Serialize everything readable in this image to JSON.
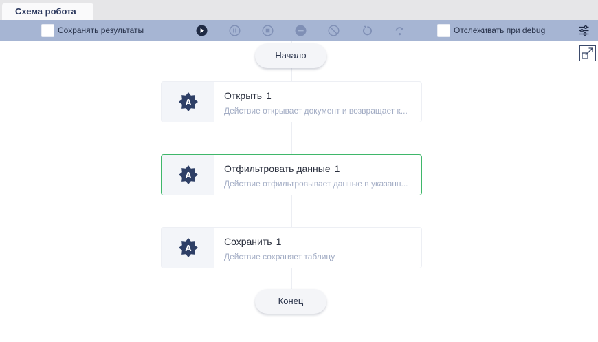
{
  "tab": {
    "label": "Схема робота"
  },
  "toolbar": {
    "save_results_label": "Сохранять результаты",
    "track_debug_label": "Отслеживать при debug",
    "buttons": [
      {
        "name": "run",
        "icon": "play-icon"
      },
      {
        "name": "pause",
        "icon": "pause-icon"
      },
      {
        "name": "stop",
        "icon": "stop-icon"
      },
      {
        "name": "disable",
        "icon": "minus-circle-icon"
      },
      {
        "name": "block",
        "icon": "forbidden-icon"
      },
      {
        "name": "restart",
        "icon": "restart-icon"
      },
      {
        "name": "step-over",
        "icon": "step-over-icon"
      }
    ],
    "settings_icon": "sliders-icon"
  },
  "flow": {
    "start_label": "Начало",
    "end_label": "Конец",
    "nodes": [
      {
        "title": "Открыть",
        "number": "1",
        "description": "Действие открывает документ и возвращает к...",
        "selected": false
      },
      {
        "title": "Отфильтровать данные",
        "number": "1",
        "description": "Действие отфильтровывает данные в указанн...",
        "selected": true
      },
      {
        "title": "Сохранить",
        "number": "1",
        "description": "Действие сохраняет таблицу",
        "selected": false
      }
    ]
  },
  "colors": {
    "toolbar_bg": "#a6b5d3",
    "toolbar_icon_active": "#1f2a44",
    "toolbar_icon_muted": "#7f8fb5",
    "node_icon": "#2e3f66",
    "selected_border": "#3fb76a"
  }
}
